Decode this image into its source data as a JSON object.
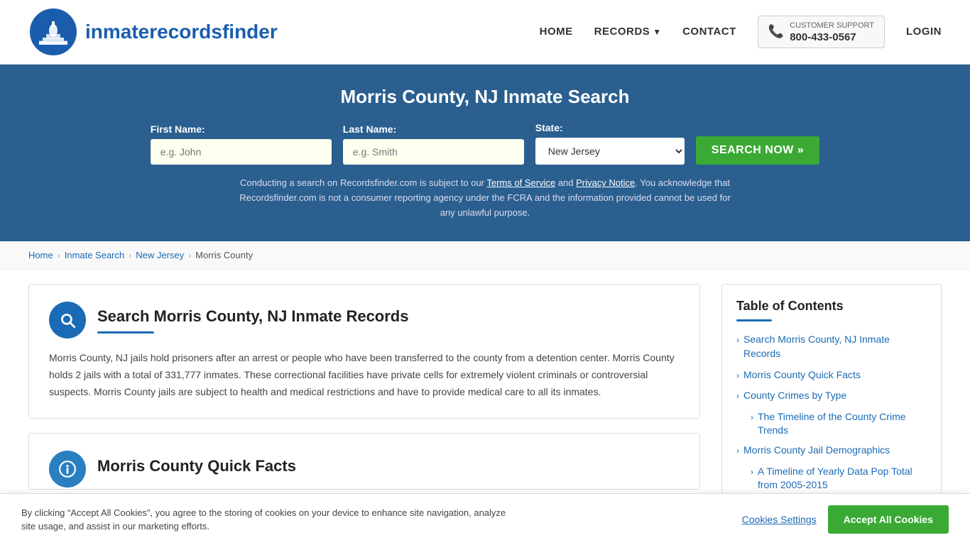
{
  "header": {
    "logo_text_normal": "inmaterecords",
    "logo_text_bold": "finder",
    "nav_home": "HOME",
    "nav_records": "RECORDS",
    "nav_contact": "CONTACT",
    "support_label": "CUSTOMER SUPPORT",
    "support_number": "800-433-0567",
    "nav_login": "LOGIN"
  },
  "hero": {
    "title": "Morris County, NJ Inmate Search",
    "first_name_label": "First Name:",
    "first_name_placeholder": "e.g. John",
    "last_name_label": "Last Name:",
    "last_name_placeholder": "e.g. Smith",
    "state_label": "State:",
    "state_value": "New Jersey",
    "search_button": "SEARCH NOW »",
    "disclaimer": "Conducting a search on Recordsfinder.com is subject to our Terms of Service and Privacy Notice. You acknowledge that Recordsfinder.com is not a consumer reporting agency under the FCRA and the information provided cannot be used for any unlawful purpose."
  },
  "breadcrumb": {
    "home": "Home",
    "inmate_search": "Inmate Search",
    "new_jersey": "New Jersey",
    "current": "Morris County"
  },
  "main_section": {
    "title": "Search Morris County, NJ Inmate Records",
    "body": "Morris County, NJ jails hold prisoners after an arrest or people who have been transferred to the county from a detention center. Morris County holds 2 jails with a total of 331,777 inmates. These correctional facilities have private cells for extremely violent criminals or controversial suspects. Morris County jails are subject to health and medical restrictions and have to provide medical care to all its inmates."
  },
  "partial_section": {
    "title": "Morris County Quick Facts"
  },
  "sidebar": {
    "title": "Table of Contents",
    "items": [
      {
        "label": "Search Morris County, NJ Inmate Records",
        "sub": false
      },
      {
        "label": "Morris County Quick Facts",
        "sub": false
      },
      {
        "label": "County Crimes by Type",
        "sub": false
      },
      {
        "label": "The Timeline of the County Crime Trends",
        "sub": true
      },
      {
        "label": "Morris County Jail Demographics",
        "sub": false
      },
      {
        "label": "A Timeline of Yearly Data Pop Total from 2005-2015",
        "sub": true
      }
    ]
  },
  "cookie_banner": {
    "text": "By clicking “Accept All Cookies”, you agree to the storing of cookies on your device to enhance site navigation, analyze site usage, and assist in our marketing efforts.",
    "settings_label": "Cookies Settings",
    "accept_label": "Accept All Cookies"
  }
}
